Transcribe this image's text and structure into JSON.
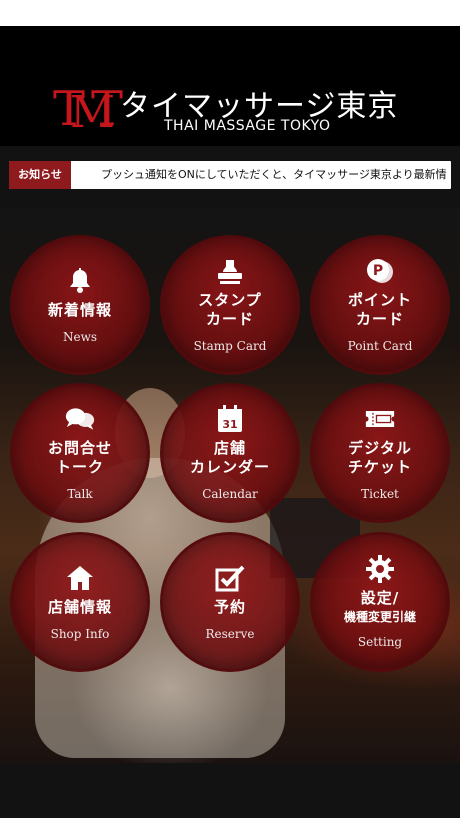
{
  "header": {
    "logo_mark": [
      "T",
      "M",
      "T"
    ],
    "logo_jp": "タイマッサージ東京",
    "logo_en": "THAI MASSAGE TOKYO"
  },
  "notice": {
    "badge": "お知らせ",
    "text": "プッシュ通知をONにしていただくと、タイマッサージ東京より最新情"
  },
  "menu": [
    {
      "jp": "新着情報",
      "en": "News",
      "icon": "bell-icon"
    },
    {
      "jp": "スタンプ\nカード",
      "en": "Stamp Card",
      "icon": "stamp-icon"
    },
    {
      "jp": "ポイント\nカード",
      "en": "Point Card",
      "icon": "point-coin-icon",
      "icon_text": "P"
    },
    {
      "jp": "お問合せ\nトーク",
      "en": "Talk",
      "icon": "chat-bubbles-icon"
    },
    {
      "jp": "店舗\nカレンダー",
      "en": "Calendar",
      "icon": "calendar-icon",
      "icon_text": "31"
    },
    {
      "jp": "デジタル\nチケット",
      "en": "Ticket",
      "icon": "ticket-icon"
    },
    {
      "jp": "店舗情報",
      "en": "Shop Info",
      "icon": "home-icon"
    },
    {
      "jp": "予約",
      "en": "Reserve",
      "icon": "checkbox-icon"
    },
    {
      "jp": "設定/",
      "jp2": "機種変更引継",
      "en": "Setting",
      "icon": "gear-icon"
    }
  ],
  "colors": {
    "brand_red": "#c4161c",
    "badge_red": "#8e1a1e",
    "button_red": "#91161a"
  }
}
